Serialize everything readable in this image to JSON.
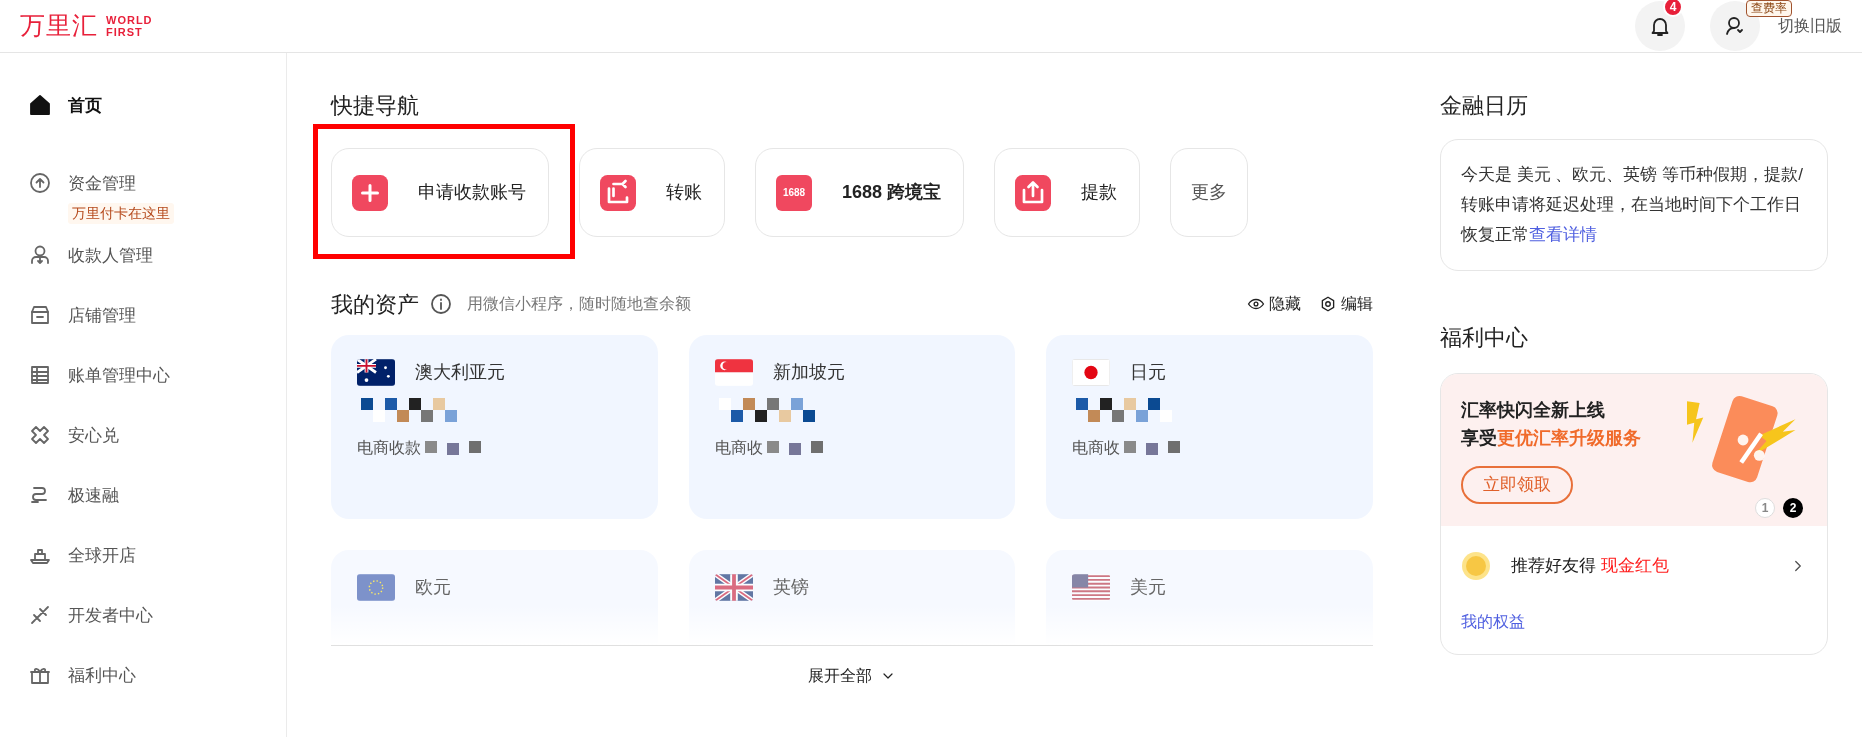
{
  "header": {
    "logo_cn": "万里汇",
    "logo_en_1": "WORLD",
    "logo_en_2": "FIRST",
    "notification_count": "4",
    "rate_tag": "查费率",
    "switch_label": "切换旧版"
  },
  "sidebar": {
    "items": [
      {
        "label": "首页",
        "selected": true
      },
      {
        "label": "资金管理",
        "selected": false,
        "tag": "万里付卡在这里"
      },
      {
        "label": "收款人管理",
        "selected": false
      },
      {
        "label": "店铺管理",
        "selected": false
      },
      {
        "label": "账单管理中心",
        "selected": false
      },
      {
        "label": "安心兑",
        "selected": false
      },
      {
        "label": "极速融",
        "selected": false
      },
      {
        "label": "全球开店",
        "selected": false
      },
      {
        "label": "开发者中心",
        "selected": false
      },
      {
        "label": "福利中心",
        "selected": false
      }
    ]
  },
  "quick_nav": {
    "title": "快捷导航",
    "items": [
      {
        "label": "申请收款账号",
        "highlighted": true
      },
      {
        "label": "转账",
        "highlighted": false
      },
      {
        "label": "1688 跨境宝",
        "icon_text": "1688",
        "highlighted": false
      },
      {
        "label": "提款",
        "highlighted": false
      },
      {
        "label": "更多",
        "highlighted": false
      }
    ]
  },
  "assets": {
    "title": "我的资产",
    "hint": "用微信小程序，随时随地查余额",
    "hide_label": "隐藏",
    "edit_label": "编辑",
    "expand_label": "展开全部",
    "cards": [
      {
        "currency": "澳大利亚元",
        "note": "电商收款",
        "faded": false
      },
      {
        "currency": "新加坡元",
        "note": "电商收",
        "faded": false
      },
      {
        "currency": "日元",
        "note": "电商收",
        "faded": false
      },
      {
        "currency": "欧元",
        "faded": true
      },
      {
        "currency": "英镑",
        "faded": true
      },
      {
        "currency": "美元",
        "faded": true
      }
    ]
  },
  "calendar": {
    "title": "金融日历",
    "text": "今天是 美元 、欧元、英镑 等币种假期，提款/转账申请将延迟处理，在当地时间下个工作日恢复正常",
    "link": "查看详情"
  },
  "benefits": {
    "title": "福利中心",
    "promo_line_1": "汇率快闪全新上线",
    "promo_line_2_prefix": "享受",
    "promo_line_2_highlight": "更优汇率升级服务",
    "promo_button": "立即领取",
    "pages": [
      {
        "label": "1",
        "selected": false
      },
      {
        "label": "2",
        "selected": true
      }
    ],
    "referral_prefix": "推荐好友得",
    "referral_highlight": "现金红包",
    "my_benefits_link": "我的权益"
  }
}
